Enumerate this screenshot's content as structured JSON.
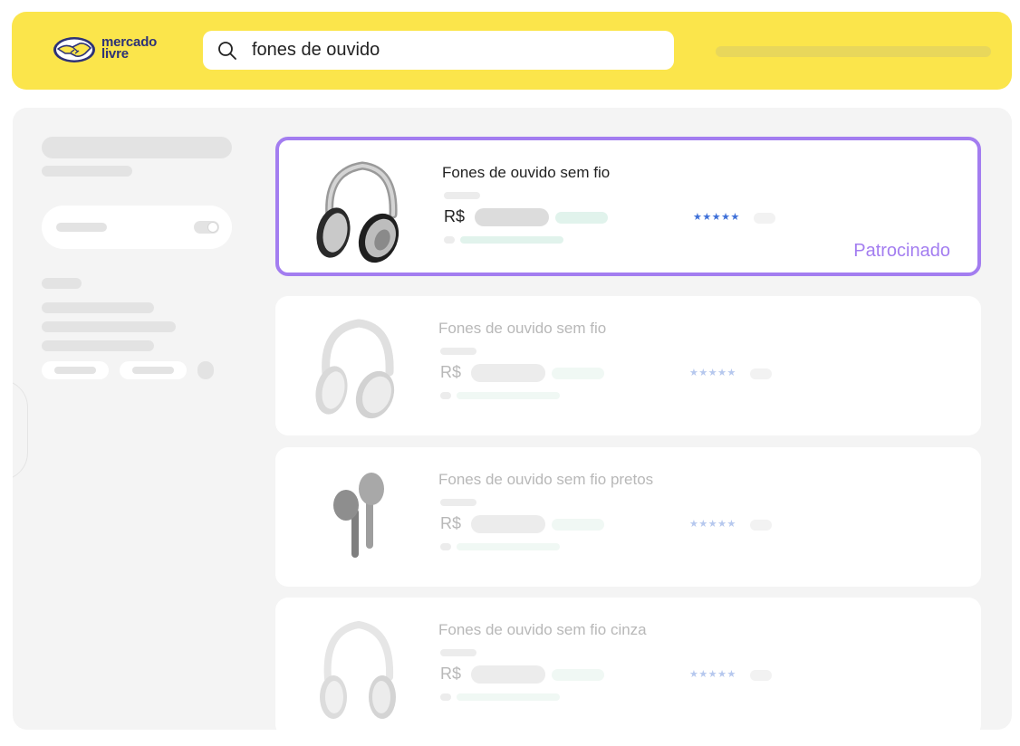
{
  "header": {
    "logo_line1": "mercado",
    "logo_line2": "livre",
    "search_value": "fones de ouvido"
  },
  "results": [
    {
      "title": "Fones de ouvido sem fio",
      "currency": "R$",
      "stars": "★★★★★",
      "badge": "Patrocinado",
      "icon": "headphones-dark-icon"
    },
    {
      "title": "Fones de ouvido sem fio",
      "currency": "R$",
      "stars": "★★★★★",
      "icon": "headphones-white-icon"
    },
    {
      "title": "Fones de ouvido sem fio pretos",
      "currency": "R$",
      "stars": "★★★★★",
      "icon": "earbuds-icon"
    },
    {
      "title": "Fones de ouvido sem fio cinza",
      "currency": "R$",
      "stars": "★★★★★",
      "icon": "headphones-light-icon"
    }
  ],
  "colors": {
    "header_bg": "#fbe54b",
    "sponsored_border": "#a37df0",
    "brand_text": "#2d3277",
    "star_color": "#3d6fd8"
  }
}
